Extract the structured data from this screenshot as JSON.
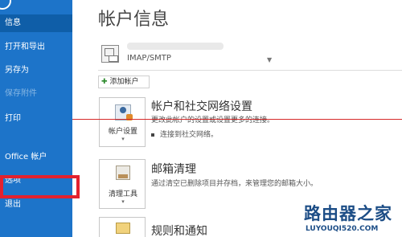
{
  "sidebar": {
    "items": [
      {
        "label": "信息",
        "state": "active"
      },
      {
        "label": "打开和导出",
        "state": "normal"
      },
      {
        "label": "另存为",
        "state": "normal"
      },
      {
        "label": "保存附件",
        "state": "disabled"
      },
      {
        "label": "打印",
        "state": "normal"
      },
      {
        "label": "Office 帐户",
        "state": "normal"
      },
      {
        "label": "选项",
        "state": "normal"
      },
      {
        "label": "退出",
        "state": "normal"
      }
    ]
  },
  "main": {
    "title": "帐户信息",
    "account": {
      "type": "IMAP/SMTP"
    },
    "add_account_label": "添加帐户",
    "sections": [
      {
        "button_label": "帐户设置",
        "title": "帐户和社交网络设置",
        "description": "更改此帐户的设置或设置更多的连接。",
        "bullet": "连接到社交网络。"
      },
      {
        "button_label": "清理工具",
        "title": "邮箱清理",
        "description": "通过清空已删除项目并存档，来管理您的邮箱大小。"
      },
      {
        "title": "规则和通知"
      }
    ]
  },
  "watermark": {
    "title": "路由器之家",
    "url": "LUYOUQI520.COM"
  },
  "colors": {
    "sidebar_bg": "#1d74c9",
    "highlight_box": "#e3212e",
    "annotation_line": "#d62a2a"
  }
}
